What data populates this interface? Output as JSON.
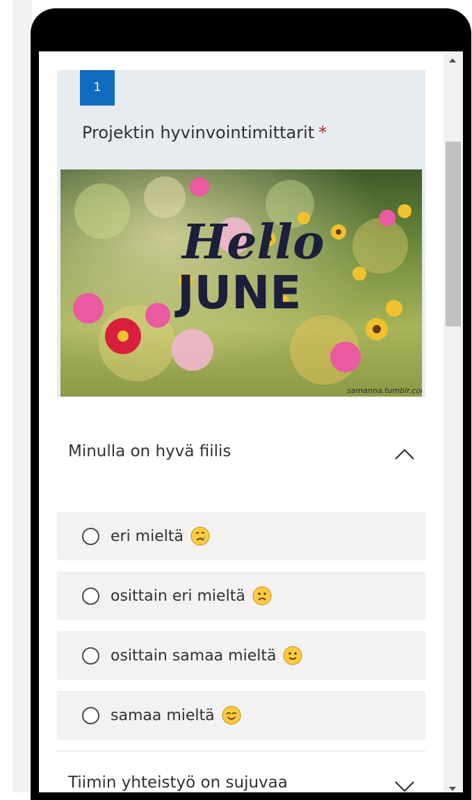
{
  "question": {
    "number": "1",
    "title": "Projektin hyvinvointimittarit",
    "required_mark": "*",
    "image": {
      "caption_line1": "Hello",
      "caption_line2": "JUNE",
      "watermark": "samanna.tumblr.com"
    }
  },
  "subquestions": [
    {
      "label": "Minulla on hyvä fiilis",
      "expanded": true,
      "options": [
        {
          "label": "eri mieltä",
          "emoji": "crying-face-icon"
        },
        {
          "label": "osittain eri mieltä",
          "emoji": "frowning-face-icon"
        },
        {
          "label": "osittain samaa mieltä",
          "emoji": "slightly-smiling-face-icon"
        },
        {
          "label": "samaa mieltä",
          "emoji": "smiling-face-icon"
        }
      ]
    },
    {
      "label": "Tiimin yhteistyö on sujuvaa",
      "expanded": false
    }
  ],
  "colors": {
    "accent": "#0f6cbd",
    "header_bg": "#e6ecf0",
    "option_bg": "#f3f2f1",
    "required": "#a4262c",
    "emoji_yellow": "#fdcb3e"
  }
}
